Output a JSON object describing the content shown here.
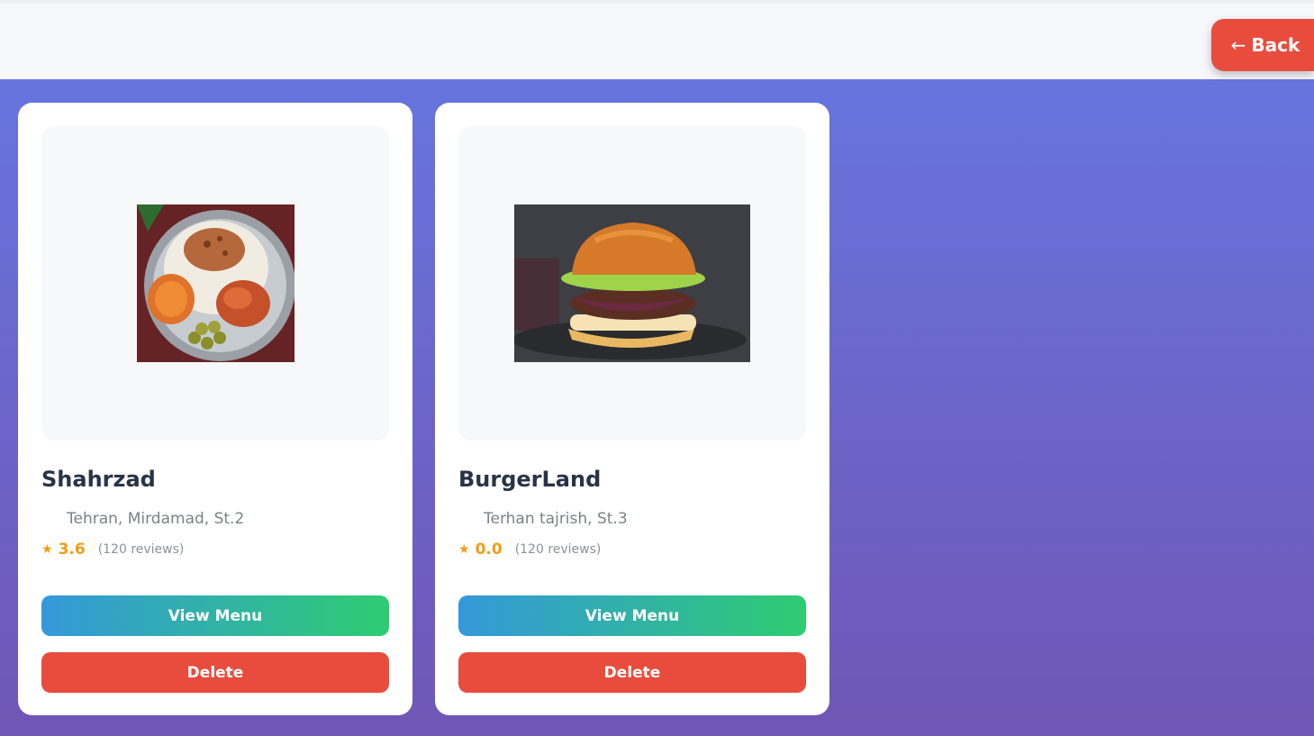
{
  "header": {
    "back_arrow": "←",
    "back_label": "Back"
  },
  "restaurants": [
    {
      "name": "Shahrzad",
      "address": "Tehran, Mirdamad, St.2",
      "rating": "3.6",
      "reviews": "(120 reviews)",
      "view_label": "View Menu",
      "delete_label": "Delete",
      "image": "persian-rice-dish"
    },
    {
      "name": "BurgerLand",
      "address": "Terhan tajrish, St.3",
      "rating": "0.0",
      "reviews": "(120 reviews)",
      "view_label": "View Menu",
      "delete_label": "Delete",
      "image": "burger"
    }
  ],
  "colors": {
    "accent_red": "#e84c3d",
    "gradient_blue": "#3498db",
    "gradient_green": "#2ecc71",
    "star": "#f39c12"
  }
}
